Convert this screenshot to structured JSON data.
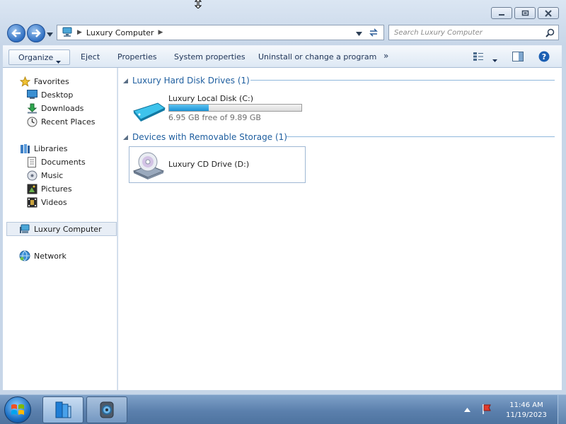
{
  "window": {
    "address": {
      "location": "Luxury Computer"
    },
    "search": {
      "placeholder": "Search Luxury Computer"
    }
  },
  "toolbar": {
    "organize": "Organize",
    "eject": "Eject",
    "properties": "Properties",
    "system_properties": "System properties",
    "uninstall": "Uninstall or change a program",
    "more": "»"
  },
  "navpane": {
    "favorites": {
      "label": "Favorites",
      "items": [
        {
          "label": "Desktop",
          "icon": "desktop-icon"
        },
        {
          "label": "Downloads",
          "icon": "downloads-icon"
        },
        {
          "label": "Recent Places",
          "icon": "recent-places-icon"
        }
      ]
    },
    "libraries": {
      "label": "Libraries",
      "items": [
        {
          "label": "Documents",
          "icon": "documents-icon"
        },
        {
          "label": "Music",
          "icon": "music-icon"
        },
        {
          "label": "Pictures",
          "icon": "pictures-icon"
        },
        {
          "label": "Videos",
          "icon": "videos-icon"
        }
      ]
    },
    "computer": {
      "label": "Luxury Computer",
      "selected": true
    },
    "network": {
      "label": "Network"
    }
  },
  "content": {
    "groups": [
      {
        "header": "Luxury Hard Disk Drives (1)",
        "items": [
          {
            "name": "Luxury Local Disk (C:)",
            "free_text": "6.95 GB free of 9.89 GB",
            "used_fraction": 0.297
          }
        ]
      },
      {
        "header": "Devices with Removable Storage (1)",
        "items": [
          {
            "name": "Luxury CD Drive (D:)"
          }
        ]
      }
    ]
  },
  "taskbar": {
    "clock": {
      "time": "11:46 AM",
      "date": "11/19/2023"
    }
  },
  "colors": {
    "accent": "#1e5e9f",
    "disk_fill": "#1a93d7",
    "taskbar": "#5b80ad"
  }
}
